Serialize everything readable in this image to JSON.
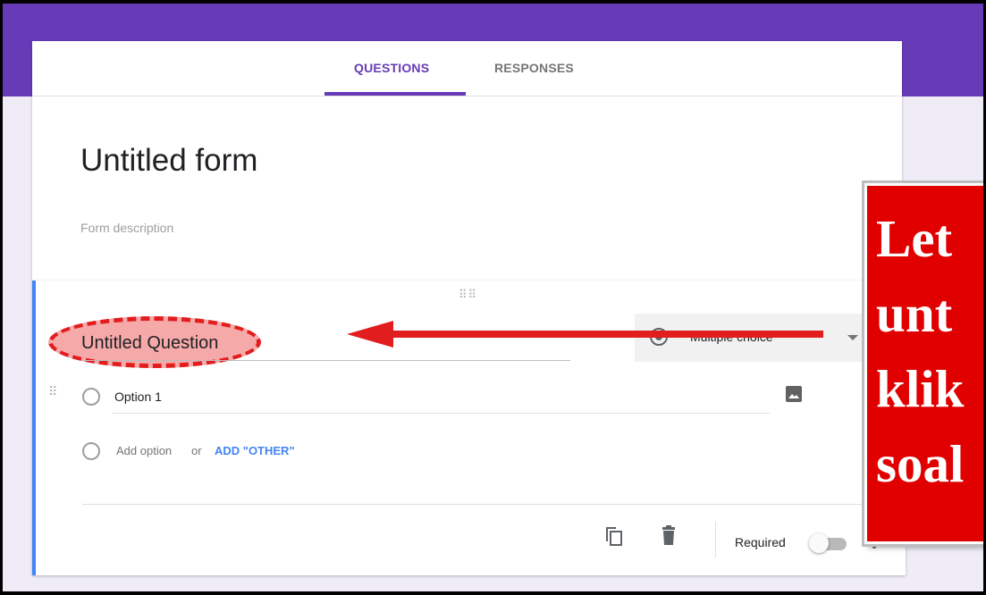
{
  "tabs": {
    "questions": "QUESTIONS",
    "responses": "RESPONSES"
  },
  "form": {
    "title": "Untitled form",
    "description_placeholder": "Form description"
  },
  "question": {
    "title": "Untitled Question",
    "type": "Multiple choice",
    "options": [
      {
        "label": "Option 1"
      }
    ],
    "add_option": "Add option",
    "or_text": "or",
    "add_other": "ADD \"OTHER\"",
    "required_label": "Required",
    "required_on": false
  },
  "callout": {
    "lines": [
      "Let",
      "unt",
      "klik",
      "soal"
    ]
  },
  "colors": {
    "accent": "#673ab7",
    "background": "#efecf7",
    "question_border": "#4285f4",
    "annotation_red": "#e00000"
  },
  "icons": [
    "drag-handle-icon",
    "radio-icon",
    "chevron-down-icon",
    "image-icon",
    "copy-icon",
    "trash-icon",
    "more-vert-icon",
    "arrow-icon"
  ]
}
